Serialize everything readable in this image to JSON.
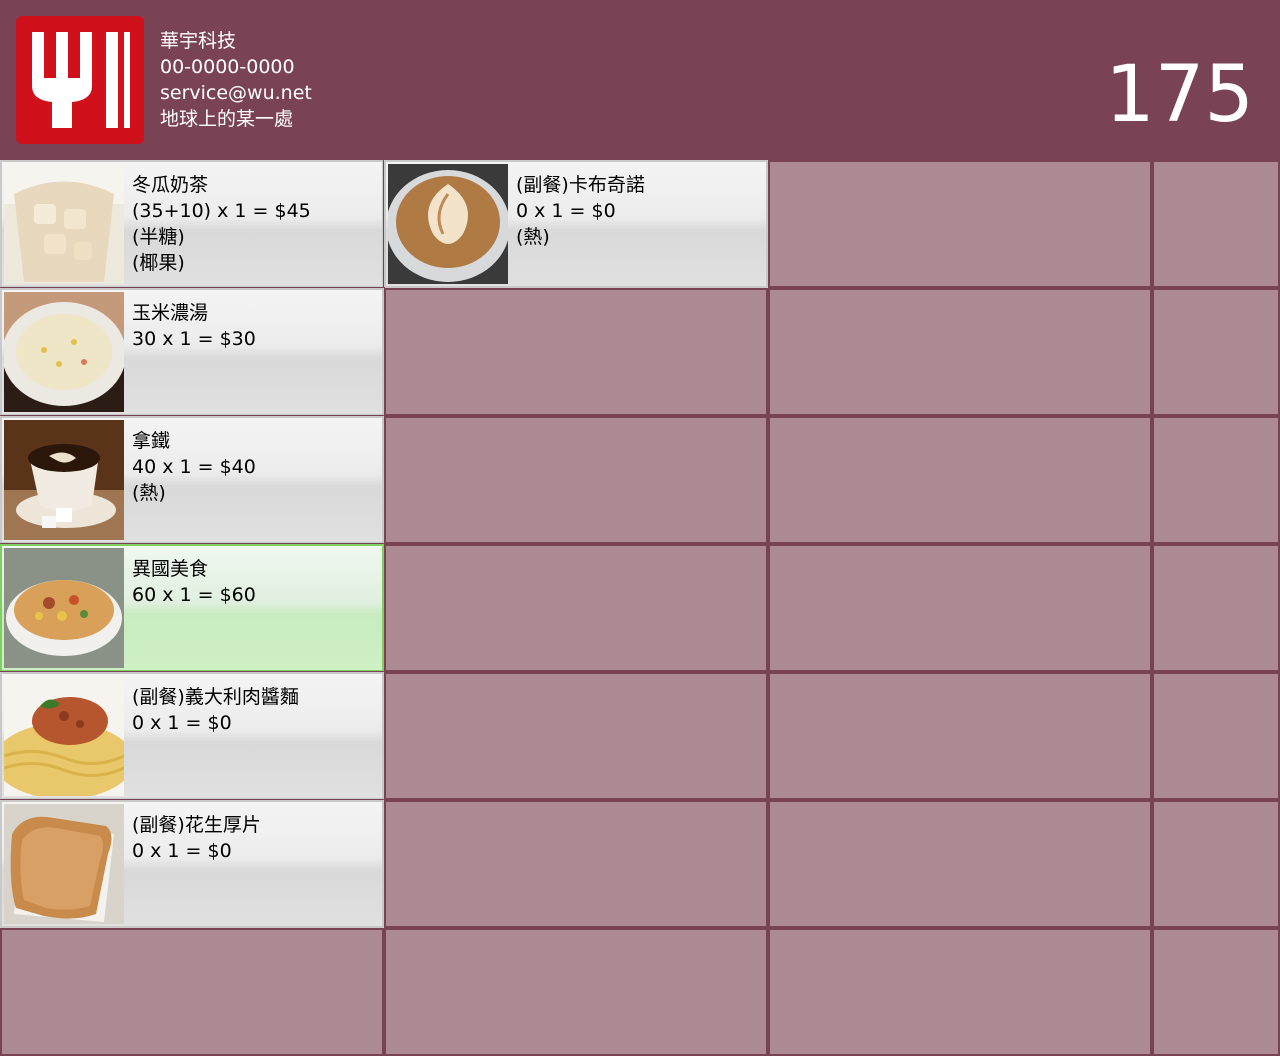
{
  "header": {
    "company_name": "華宇科技",
    "phone": "00-0000-0000",
    "email": "service@wu.net",
    "address": "地球上的某一處",
    "order_number": "175",
    "logo_icon": "fork-logo-icon",
    "colors": {
      "background": "#7a4255",
      "logo": "#d0101a",
      "empty_cell": "#ab8a94",
      "selected_border": "#7fd062"
    }
  },
  "order_items": [
    {
      "name": "冬瓜奶茶",
      "price_line": "(35+10) x 1 = $45",
      "options": [
        "(半糖)",
        "(椰果)"
      ],
      "image": "milk-tea-image"
    },
    {
      "name": "(副餐)卡布奇諾",
      "price_line": "0 x 1 = $0",
      "options": [
        "(熱)"
      ],
      "image": "cappuccino-image"
    },
    {
      "name": "玉米濃湯",
      "price_line": "30 x 1 = $30",
      "options": [],
      "image": "corn-soup-image"
    },
    {
      "name": "拿鐵",
      "price_line": "40 x 1 = $40",
      "options": [
        "(熱)"
      ],
      "image": "latte-image"
    },
    {
      "name": "異國美食",
      "price_line": "60 x 1 = $60",
      "options": [],
      "image": "gratin-image",
      "selected": true
    },
    {
      "name": "(副餐)義大利肉醬麵",
      "price_line": "0 x 1 = $0",
      "options": [],
      "image": "spaghetti-image"
    },
    {
      "name": "(副餐)花生厚片",
      "price_line": "0 x 1 = $0",
      "options": [],
      "image": "peanut-toast-image"
    }
  ]
}
